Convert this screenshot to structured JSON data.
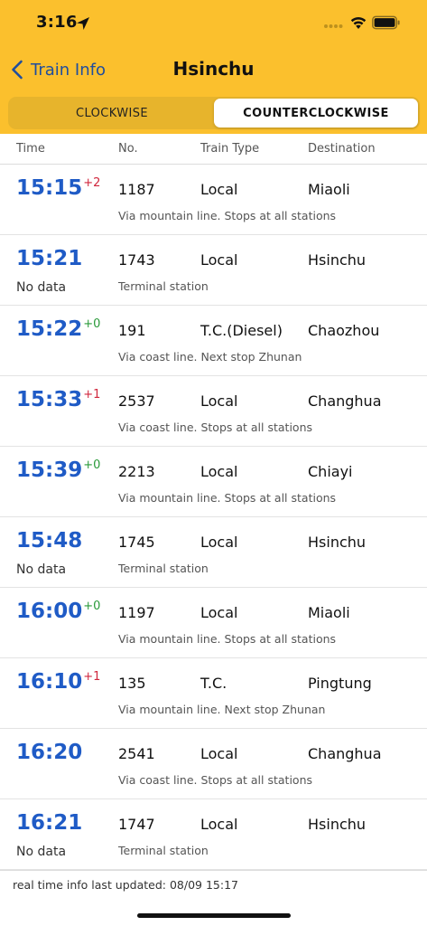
{
  "status_bar": {
    "time": "3:16"
  },
  "nav": {
    "back_label": "Train Info",
    "title": "Hsinchu"
  },
  "segments": [
    {
      "label": "CLOCKWISE",
      "active": false
    },
    {
      "label": "COUNTERCLOCKWISE",
      "active": true
    }
  ],
  "columns": {
    "time": "Time",
    "number": "No.",
    "train_type": "Train Type",
    "destination": "Destination"
  },
  "trains": [
    {
      "time": "15:15",
      "delay": "+2",
      "delay_status": "late",
      "number": "1187",
      "type": "Local",
      "destination": "Miaoli",
      "info": "Via mountain line. Stops at all stations",
      "no_data": ""
    },
    {
      "time": "15:21",
      "delay": "",
      "delay_status": "",
      "number": "1743",
      "type": "Local",
      "destination": "Hsinchu",
      "info": "Terminal station",
      "no_data": "No data"
    },
    {
      "time": "15:22",
      "delay": "+0",
      "delay_status": "ontime",
      "number": "191",
      "type": "T.C.(Diesel)",
      "destination": "Chaozhou",
      "info": "Via coast line. Next stop Zhunan",
      "no_data": ""
    },
    {
      "time": "15:33",
      "delay": "+1",
      "delay_status": "late",
      "number": "2537",
      "type": "Local",
      "destination": "Changhua",
      "info": "Via coast line. Stops at all stations",
      "no_data": ""
    },
    {
      "time": "15:39",
      "delay": "+0",
      "delay_status": "ontime",
      "number": "2213",
      "type": "Local",
      "destination": "Chiayi",
      "info": "Via mountain line. Stops at all stations",
      "no_data": ""
    },
    {
      "time": "15:48",
      "delay": "",
      "delay_status": "",
      "number": "1745",
      "type": "Local",
      "destination": "Hsinchu",
      "info": "Terminal station",
      "no_data": "No data"
    },
    {
      "time": "16:00",
      "delay": "+0",
      "delay_status": "ontime",
      "number": "1197",
      "type": "Local",
      "destination": "Miaoli",
      "info": "Via mountain line. Stops at all stations",
      "no_data": ""
    },
    {
      "time": "16:10",
      "delay": "+1",
      "delay_status": "late",
      "number": "135",
      "type": "T.C.",
      "destination": "Pingtung",
      "info": "Via mountain line. Next stop Zhunan",
      "no_data": ""
    },
    {
      "time": "16:20",
      "delay": "",
      "delay_status": "",
      "number": "2541",
      "type": "Local",
      "destination": "Changhua",
      "info": "Via coast line. Stops at all stations",
      "no_data": ""
    },
    {
      "time": "16:21",
      "delay": "",
      "delay_status": "",
      "number": "1747",
      "type": "Local",
      "destination": "Hsinchu",
      "info": "Terminal station",
      "no_data": "No data"
    }
  ],
  "footer": {
    "updated": "real time info last updated: 08/09 15:17"
  },
  "colors": {
    "header_bg": "#fbc02d",
    "time_blue": "#1f5bc6",
    "late_red": "#d0263c",
    "ontime_green": "#2a9a3a",
    "back_blue": "#1f4d9e"
  },
  "icons": {
    "location": "location-arrow-icon",
    "wifi": "wifi-icon",
    "battery": "battery-icon",
    "back": "chevron-left-icon"
  }
}
